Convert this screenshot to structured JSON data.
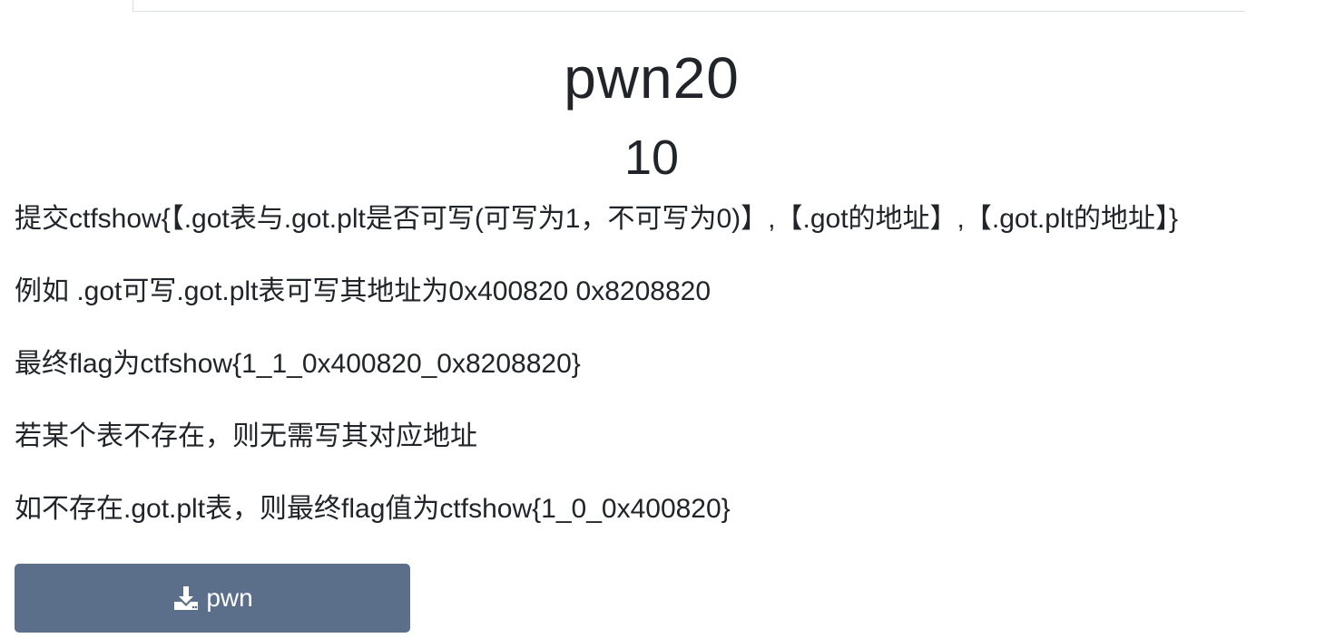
{
  "challenge": {
    "title": "pwn20",
    "points": "10"
  },
  "description": {
    "lines": [
      "提交ctfshow{【.got表与.got.plt是否可写(可写为1，不可写为0)】,【.got的地址】,【.got.plt的地址】}",
      "例如 .got可写.got.plt表可写其地址为0x400820 0x8208820",
      "最终flag为ctfshow{1_1_0x400820_0x8208820}",
      "若某个表不存在，则无需写其对应地址",
      "如不存在.got.plt表，则最终flag值为ctfshow{1_0_0x400820}"
    ]
  },
  "download": {
    "label": "pwn",
    "icon": "download-icon",
    "color": "#5c6f8a"
  }
}
